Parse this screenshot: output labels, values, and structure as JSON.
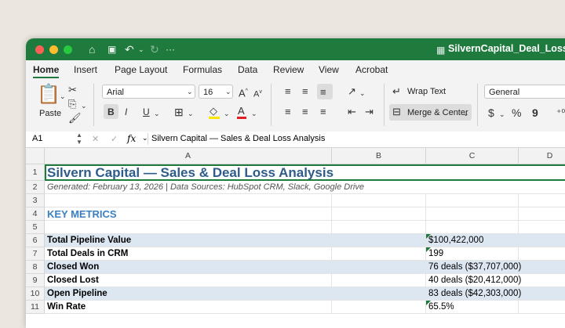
{
  "window": {
    "title": "SilvernCapital_Deal_Loss",
    "accent_color": "#1f7a3e"
  },
  "titlebar_icons": [
    "home-icon",
    "save-icon",
    "undo-icon",
    "redo-icon"
  ],
  "tabs": [
    {
      "label": "Home",
      "active": true
    },
    {
      "label": "Insert"
    },
    {
      "label": "Page Layout"
    },
    {
      "label": "Formulas"
    },
    {
      "label": "Data"
    },
    {
      "label": "Review"
    },
    {
      "label": "View"
    },
    {
      "label": "Acrobat"
    }
  ],
  "ribbon": {
    "paste_label": "Paste",
    "font_name": "Arial",
    "font_size": "16",
    "bold": "B",
    "italic": "I",
    "underline": "U",
    "wrap_text": "Wrap Text",
    "merge_center": "Merge & Center",
    "number_format": "General",
    "currency_symbol": "$",
    "percent_symbol": "%",
    "comma_symbol": "9",
    "grow_font": "A",
    "shrink_font": "A",
    "font_color_letter": "A"
  },
  "formula_bar": {
    "cell_ref": "A1",
    "fx": "fx",
    "content": "Silvern Capital — Sales & Deal Loss Analysis"
  },
  "columns": [
    "A",
    "B",
    "C",
    "D"
  ],
  "rows": [
    {
      "num": "1",
      "a": "Silvern Capital — Sales & Deal Loss Analysis",
      "c": "",
      "style": "title"
    },
    {
      "num": "2",
      "a": "Generated: February 13, 2026 | Data Sources: HubSpot CRM, Slack, Google Drive",
      "c": "",
      "style": "subtitle"
    },
    {
      "num": "3",
      "a": "",
      "c": "",
      "style": "plain"
    },
    {
      "num": "4",
      "a": "KEY METRICS",
      "c": "",
      "style": "section"
    },
    {
      "num": "5",
      "a": "",
      "c": "",
      "style": "plain"
    },
    {
      "num": "6",
      "a": "Total Pipeline Value",
      "c": "$100,422,000",
      "style": "metric",
      "band": true,
      "flag": true
    },
    {
      "num": "7",
      "a": "Total Deals in CRM",
      "c": "199",
      "style": "metric",
      "band": false,
      "flag": true
    },
    {
      "num": "8",
      "a": "Closed Won",
      "c": "76 deals ($37,707,000)",
      "style": "metric",
      "band": true
    },
    {
      "num": "9",
      "a": "Closed Lost",
      "c": "40 deals ($20,412,000)",
      "style": "metric",
      "band": false
    },
    {
      "num": "10",
      "a": "Open Pipeline",
      "c": "83 deals ($42,303,000)",
      "style": "metric",
      "band": true
    },
    {
      "num": "11",
      "a": "Win Rate",
      "c": "65.5%",
      "style": "metric",
      "band": false,
      "flag": true
    }
  ]
}
